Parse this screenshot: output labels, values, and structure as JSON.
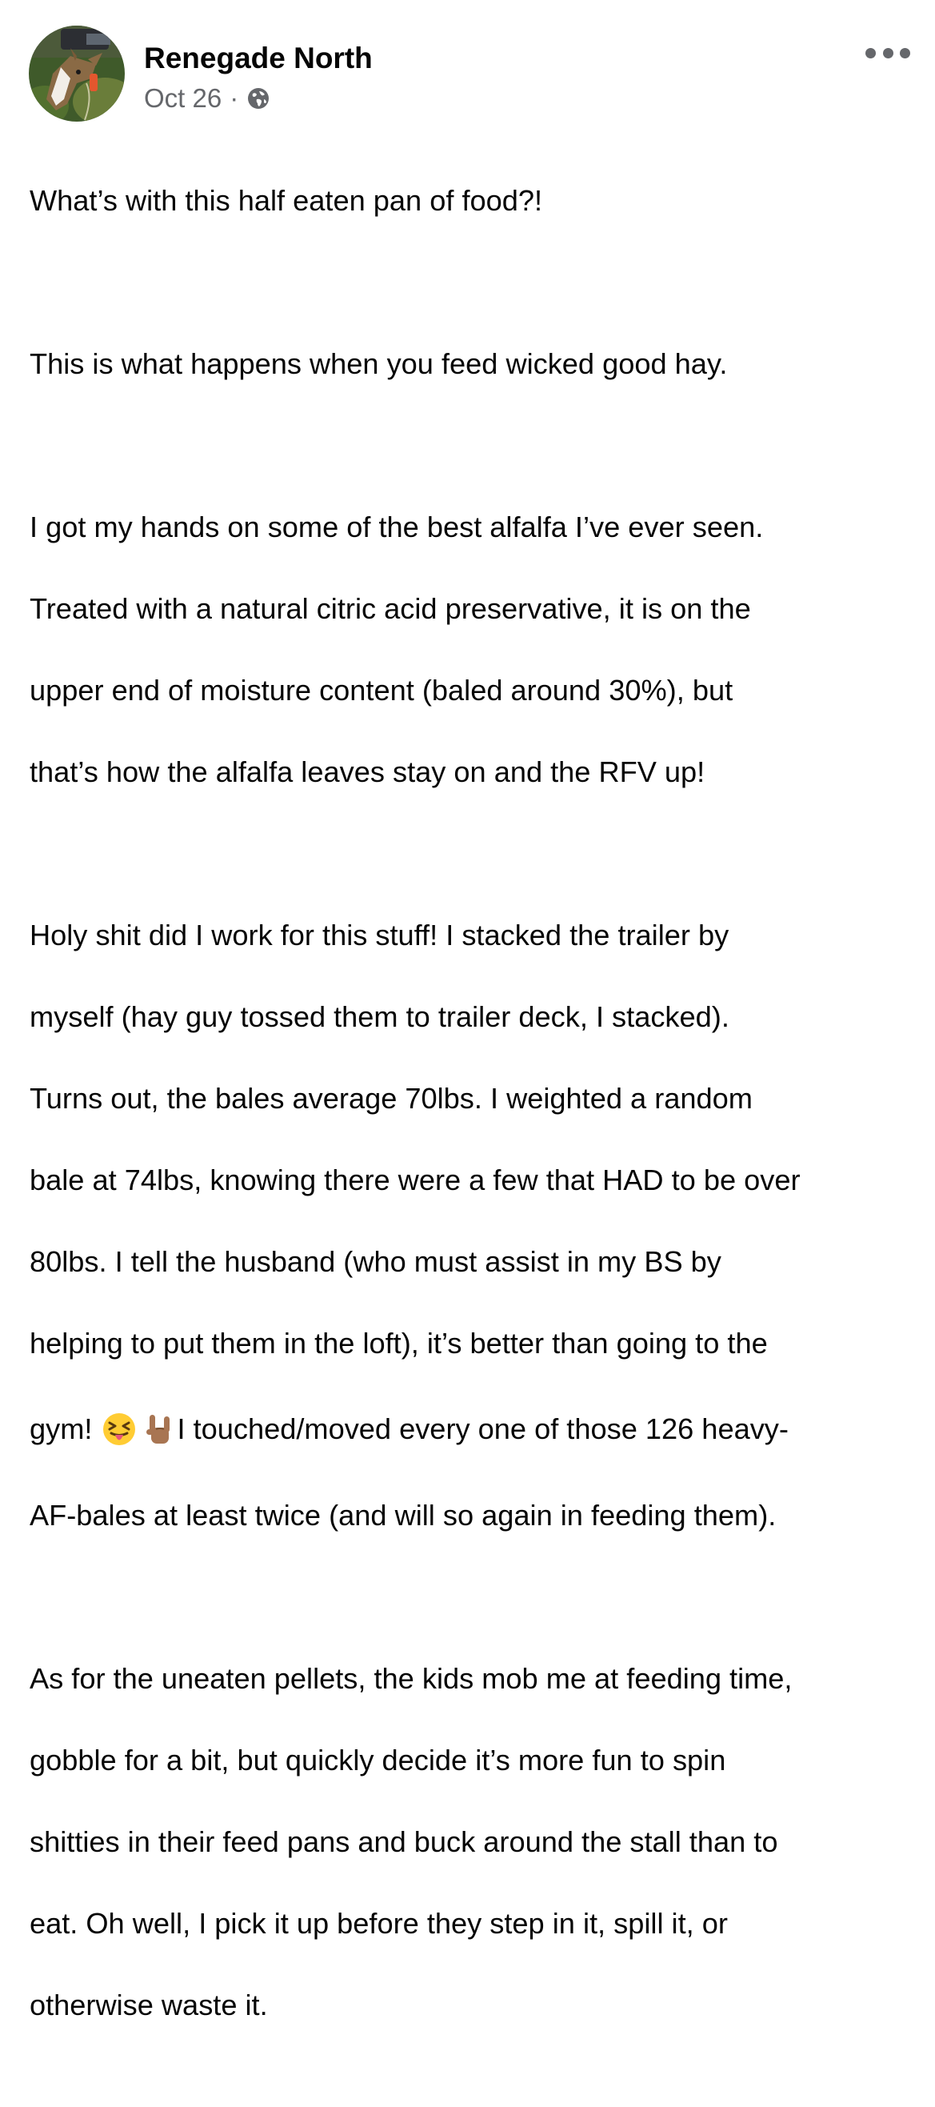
{
  "post": {
    "author": "Renegade North",
    "date": "Oct 26",
    "separator": "·",
    "audience_icon": "globe-icon",
    "more_icon": "more-options-icon",
    "paragraphs": [
      {
        "lines": [
          "What’s with this half eaten pan of food?!"
        ]
      },
      {
        "lines": [
          "This is what happens when you feed wicked good hay."
        ]
      },
      {
        "lines": [
          "I got my hands on some of the best alfalfa I’ve ever seen.",
          "Treated with a natural citric acid preservative, it is on the",
          "upper end of moisture content (baled around 30%), but",
          "that’s how the alfalfa leaves stay on and the RFV up!"
        ]
      },
      {
        "lines": [
          "Holy shit did I work for this stuff! I stacked the trailer by",
          "myself (hay guy tossed them to trailer deck, I stacked).",
          "Turns out, the bales average 70lbs. I weighted a random",
          "bale at 74lbs, knowing there were a few that HAD to be over",
          "80lbs. I tell the husband (who must assist in my BS by",
          "helping to put them in the loft), it’s better than going to the"
        ],
        "emoji_line": {
          "before": "gym!",
          "emojis": [
            "squinting-tongue-face-emoji",
            "rock-on-hand-emoji"
          ],
          "after": "I touched/moved every one of those 126 heavy-"
        },
        "tail_lines": [
          "AF-bales at least twice (and will so again in feeding them)."
        ]
      },
      {
        "lines": [
          "As for the uneaten pellets, the kids mob me at feeding time,",
          "gobble for a bit, but quickly decide it’s more fun to spin",
          "shitties in their feed pans and buck around the stall than to",
          "eat.  Oh well, I pick it up before they step in it, spill it, or",
          "otherwise waste it."
        ]
      }
    ]
  },
  "colors": {
    "text": "#050505",
    "secondary": "#65676b",
    "background": "#ffffff"
  }
}
